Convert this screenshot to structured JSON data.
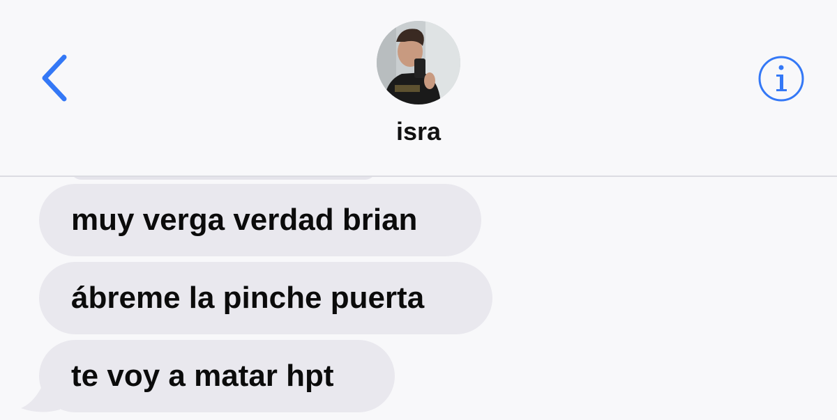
{
  "header": {
    "back_icon": "chevron-left-icon",
    "contact_name": "isra",
    "avatar": "contact-avatar-photo",
    "info_icon": "info-icon",
    "accent_color": "#3478f6"
  },
  "messages": [
    {
      "text": "muy verga verdad brian",
      "direction": "received"
    },
    {
      "text": "ábreme la pinche puerta",
      "direction": "received"
    },
    {
      "text": "te voy a matar hpt",
      "direction": "received"
    }
  ],
  "colors": {
    "background": "#f8f8fa",
    "received_bubble": "#e9e8ee",
    "text": "#0b0b0b"
  }
}
